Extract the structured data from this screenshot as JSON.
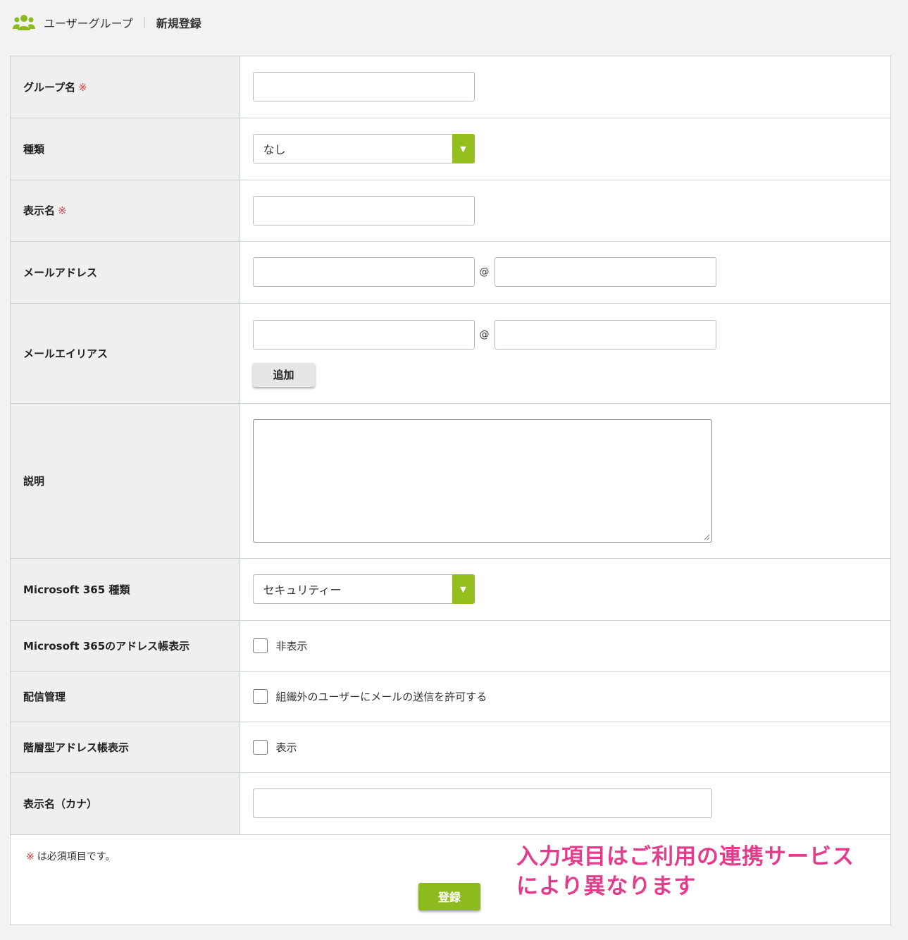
{
  "breadcrumb": {
    "section_icon": "users-icon",
    "section_title": "ユーザーグループ",
    "page_title": "新規登録"
  },
  "colors": {
    "accent": "#95be1f",
    "required_mark": "#e04040",
    "annotation": "#e23c8c"
  },
  "form": {
    "required_mark": "※",
    "group_name": {
      "label": "グループ名",
      "value": ""
    },
    "type": {
      "label": "種類",
      "selected": "なし"
    },
    "display_name": {
      "label": "表示名",
      "value": ""
    },
    "email": {
      "label": "メールアドレス",
      "local": "",
      "at": "@",
      "domain": ""
    },
    "email_alias": {
      "label": "メールエイリアス",
      "local": "",
      "at": "@",
      "domain": "",
      "add_button": "追加"
    },
    "description": {
      "label": "説明",
      "value": ""
    },
    "ms365_type": {
      "label": "Microsoft 365 種類",
      "selected": "セキュリティー"
    },
    "ms365_address_book": {
      "label": "Microsoft 365のアドレス帳表示",
      "option": "非表示",
      "checked": false
    },
    "delivery": {
      "label": "配信管理",
      "option": "組織外のユーザーにメールの送信を許可する",
      "checked": false
    },
    "hierarchical_address_book": {
      "label": "階層型アドレス帳表示",
      "option": "表示",
      "checked": false
    },
    "display_name_kana": {
      "label": "表示名（カナ）",
      "value": ""
    }
  },
  "footer": {
    "required_mark": "※",
    "required_note": "は必須項目です。",
    "submit_label": "登録",
    "annotation_line1": "入力項目はご利用の連携サービス",
    "annotation_line2": "により異なります"
  }
}
